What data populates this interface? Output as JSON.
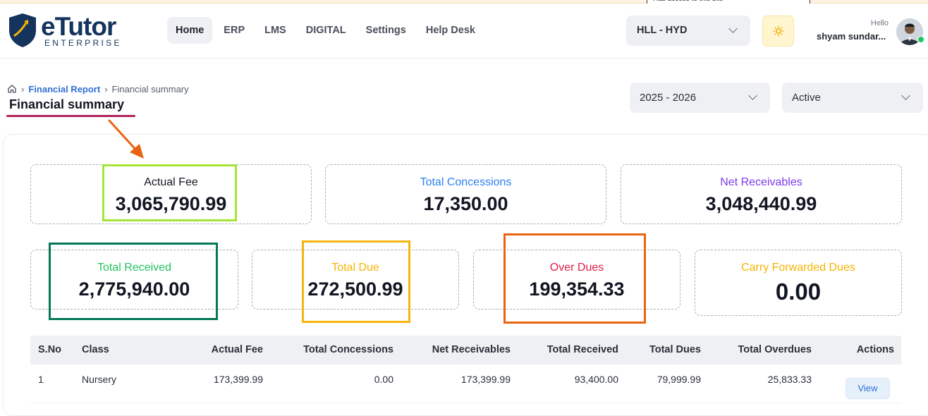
{
  "tooltip": "Has access to this site",
  "brand": {
    "name": "eTutor",
    "tagline": "ENTERPRISE"
  },
  "nav": [
    {
      "label": "Home",
      "active": true
    },
    {
      "label": "ERP"
    },
    {
      "label": "LMS"
    },
    {
      "label": "DIGITAL"
    },
    {
      "label": "Settings"
    },
    {
      "label": "Help Desk"
    }
  ],
  "branch": {
    "value": "HLL - HYD"
  },
  "user": {
    "greeting": "Hello",
    "name": "shyam sundar..."
  },
  "breadcrumb": {
    "parent": "Financial Report",
    "current": "Financial summary"
  },
  "page_title": "Financial summary",
  "filters": {
    "year": "2025 - 2026",
    "status": "Active"
  },
  "stats": {
    "actual_fee": {
      "label": "Actual Fee",
      "value": "3,065,790.99",
      "color": "#121622"
    },
    "total_concessions": {
      "label": "Total Concessions",
      "value": "17,350.00",
      "color": "#2f80ed"
    },
    "net_receivables": {
      "label": "Net Receivables",
      "value": "3,048,440.99",
      "color": "#7c3aed"
    },
    "total_received": {
      "label": "Total Received",
      "value": "2,775,940.00",
      "color": "#22c55e"
    },
    "total_due": {
      "label": "Total Due",
      "value": "272,500.99",
      "color": "#f5b301"
    },
    "over_dues": {
      "label": "Over Dues",
      "value": "199,354.33",
      "color": "#e11d48"
    },
    "carry_forwarded": {
      "label": "Carry Forwarded Dues",
      "value": "0.00",
      "color": "#f5b301"
    }
  },
  "annotation_colors": {
    "actual": "#a3e635",
    "received": "#047857",
    "due": "#f6b40e",
    "over": "#ea6410",
    "arrow": "#ea6410"
  },
  "table": {
    "headers": [
      "S.No",
      "Class",
      "Actual Fee",
      "Total Concessions",
      "Net Receivables",
      "Total Received",
      "Total Dues",
      "Total Overdues",
      "Actions"
    ],
    "rows": [
      {
        "sno": "1",
        "class": "Nursery",
        "actual_fee": "173,399.99",
        "concessions": "0.00",
        "net": "173,399.99",
        "received": "93,400.00",
        "dues": "79,999.99",
        "overdues": "25,833.33",
        "action": "View"
      }
    ]
  }
}
